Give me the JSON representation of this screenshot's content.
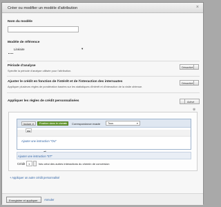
{
  "dialog": {
    "title": "Créer ou modifier un modèle d'attribution",
    "close_glyph": "×"
  },
  "model_name": {
    "label": "Nom du modèle",
    "value": ""
  },
  "reference_model": {
    "label": "Modèle de référence",
    "selected": "Linéaire",
    "options_glyph": "▾"
  },
  "analysis_period": {
    "label": "Période d'analyse",
    "description": "Spécifie la période d'analyse utilisée pour l'attribution.",
    "toggle_state": "Désactivé"
  },
  "engagement": {
    "label": "Ajuster le crédit en fonction de l'intérêt et de l'interaction des internautes",
    "description": "Appliquer plusieurs règles de pondération basées sur les statistiques d'intérêt et d'interaction de la visite obtenue.",
    "toggle_state": "Désactivé"
  },
  "custom_rules": {
    "label": "Appliquer les règles de crédit personnalisées",
    "toggle_state": "Activé",
    "remove_glyph": "⊗",
    "include_button": "Inclure",
    "position_chip": "Position dans le chemin",
    "match_label": "Correspondance exacte",
    "match_value": "Tous",
    "arrow": "▾",
    "ou_label": "ou",
    "add_or": "Ajouter une instruction \"OU\"",
    "et_label": "et",
    "add_and": "Ajouter une instruction \"ET\"",
    "credit_label": "Crédit",
    "credit_value": "1",
    "credit_suffix": "fois celui des autres interactions du chemin de conversion",
    "add_custom": "+ Appliquer un autre crédit personnalisé"
  },
  "footer": {
    "save_button": "Enregistrer et appliquer",
    "cancel_link": "Annuler"
  }
}
